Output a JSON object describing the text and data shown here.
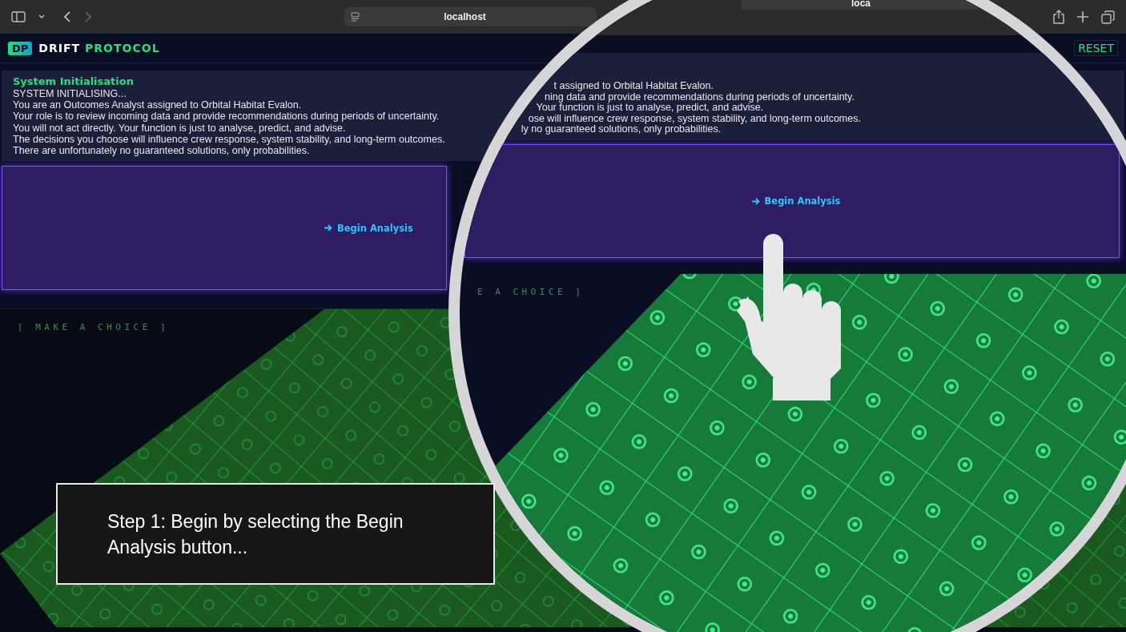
{
  "browser": {
    "url": "localhost"
  },
  "app": {
    "logo_badge": "DP",
    "title_first": "DRIFT",
    "title_second": "PROTOCOL",
    "reset": "RESET"
  },
  "intro": {
    "heading": "System Initialisation",
    "lines": [
      "SYSTEM INITIALISING...",
      "You are an Outcomes Analyst assigned to Orbital Habitat Evalon.",
      "Your role is to review incoming data and provide recommendations during periods of uncertainty.",
      "You will not act directly. Your function is just to analyse, predict, and advise.",
      "The decisions you choose will influence crew response, system stability, and long-term outcomes.",
      "There are unfortunately no guaranteed solutions, only probabilities."
    ]
  },
  "begin_button": {
    "label": "Begin Analysis"
  },
  "choice_panel": {
    "label": "[ MAKE A CHOICE ]"
  },
  "magnifier": {
    "url": "loca",
    "lines": [
      "t assigned to Orbital Habitat Evalon.",
      "ning data and provide recommendations during periods of uncertainty.",
      "Your function is just to analyse, predict, and advise.",
      "ose will influence crew response, system stability, and long-term outcomes.",
      "ly no guaranteed solutions, only probabilities."
    ],
    "begin_button": "Begin Analysis",
    "choice_label": "E A CHOICE ]"
  },
  "caption": {
    "text": "Step 1: Begin by selecting the Begin Analysis button..."
  }
}
